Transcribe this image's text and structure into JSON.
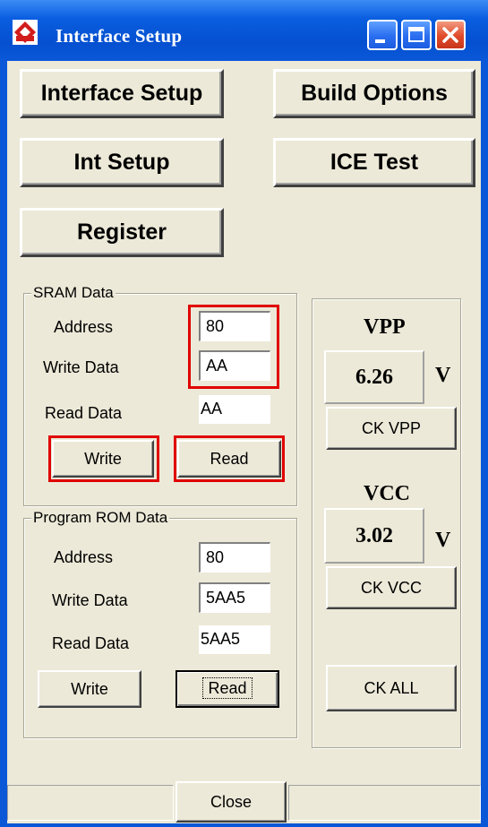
{
  "window": {
    "title": "Interface Setup",
    "icon": "app-logo-icon",
    "controls": [
      "minimize-icon",
      "maximize-icon",
      "close-icon"
    ]
  },
  "nav": {
    "interface_setup": "Interface Setup",
    "build_options": "Build Options",
    "int_setup": "Int Setup",
    "ice_test": "ICE Test",
    "register": "Register"
  },
  "sram": {
    "group_title": "SRAM Data",
    "address_label": "Address",
    "address_value": "80",
    "write_data_label": "Write Data",
    "write_data_value": "AA",
    "read_data_label": "Read Data",
    "read_data_value": "AA",
    "write_button": "Write",
    "read_button": "Read"
  },
  "rom": {
    "group_title": "Program ROM Data",
    "address_label": "Address",
    "address_value": "80",
    "write_data_label": "Write Data",
    "write_data_value": "5AA5",
    "read_data_label": "Read Data",
    "read_data_value": "5AA5",
    "write_button": "Write",
    "read_button": "Read"
  },
  "voltage": {
    "vpp_label": "VPP",
    "vpp_value": "6.26",
    "vpp_unit": "V",
    "ck_vpp_button": "CK VPP",
    "vcc_label": "VCC",
    "vcc_value": "3.02",
    "vcc_unit": "V",
    "ck_vcc_button": "CK VCC",
    "ck_all_button": "CK ALL"
  },
  "footer": {
    "close_button": "Close"
  },
  "colors": {
    "title_bar": "#0a58d8",
    "dialog_bg": "#ece9d8",
    "highlight": "#e00000"
  }
}
